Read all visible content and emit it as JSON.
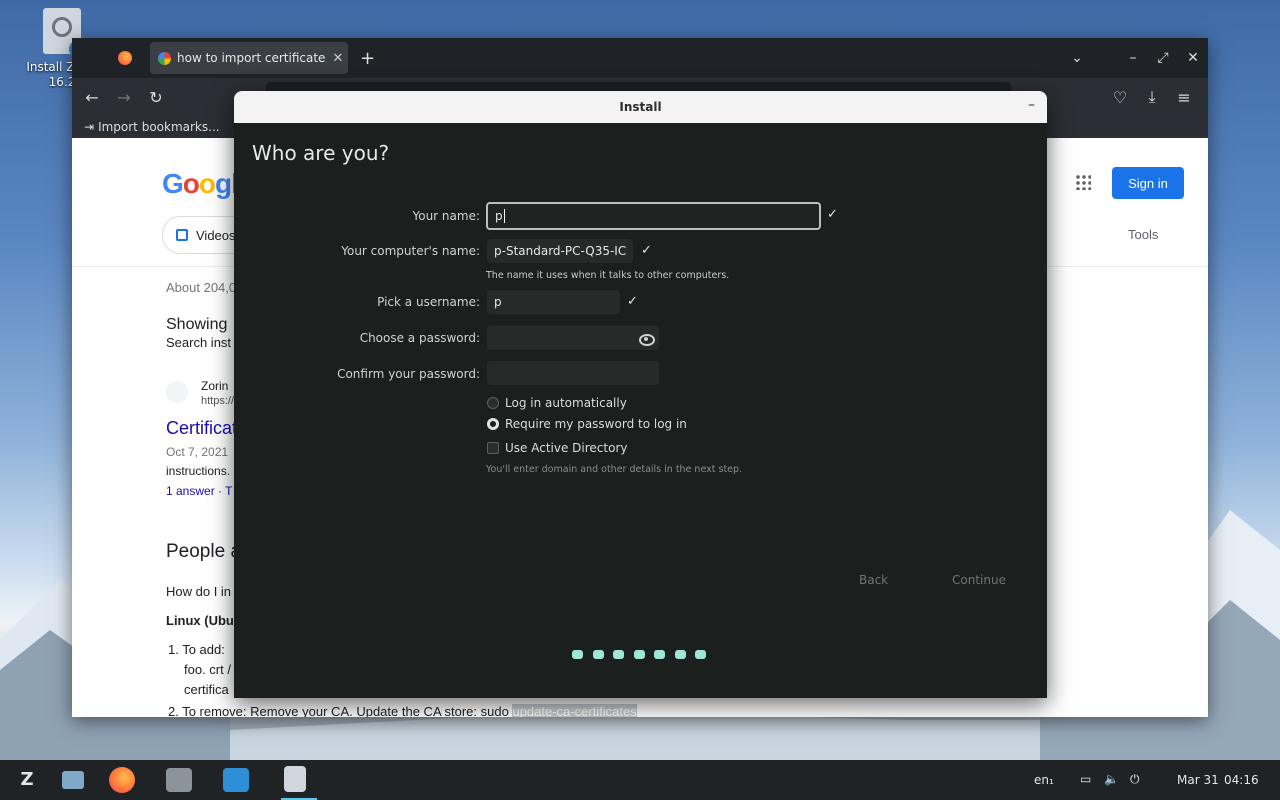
{
  "desktop": {
    "icon_label_line1": "Install Zorin",
    "icon_label_line2": "16.2"
  },
  "browser": {
    "tab_title": "how to import certificate i",
    "new_tab": "+",
    "bookmarks": {
      "import": "Import bookmarks..."
    },
    "page": {
      "signin": "Sign in",
      "videos": "Videos",
      "tools": "Tools",
      "about": "About 204,0",
      "showing": "Showing",
      "search_instead": "Search inst",
      "result_site": "Zorin",
      "result_url": "https://",
      "result_title": "Certificat",
      "result_date": "Oct 7, 2021",
      "result_snippet": "instructions.",
      "result_answers": "1 answer · T",
      "people_also": "People a",
      "how_do_i": "How do I in",
      "linux": "Linux (Ubu",
      "step1": "1. To add:",
      "step1b": "foo. crt /",
      "step1c": "certifica",
      "step2_text": "2. To remove: Remove your CA. Update the CA store: sudo ",
      "step2_highlight": "update-ca-certificates"
    }
  },
  "installer": {
    "title": "Install",
    "heading": "Who are you?",
    "fields": {
      "name_label": "Your name:",
      "name_value": "p",
      "computer_label": "Your computer's name:",
      "computer_value": "p-Standard-PC-Q35-IC",
      "computer_hint": "The name it uses when it talks to other computers.",
      "username_label": "Pick a username:",
      "username_value": "p",
      "password_label": "Choose a password:",
      "confirm_label": "Confirm your password:"
    },
    "options": {
      "auto_login": "Log in automatically",
      "require_password": "Require my password to log in",
      "active_directory": "Use Active Directory",
      "ad_hint": "You'll enter domain and other details in the next step."
    },
    "buttons": {
      "back": "Back",
      "continue": "Continue"
    },
    "progress_dots": 7
  },
  "taskbar": {
    "lang": "en₁",
    "date": "Mar 31",
    "time": "04:16"
  },
  "colors": {
    "installer_bg": "#1b1f1e",
    "accent_dots": "#9ee6d5",
    "google_blue": "#1a73e8"
  }
}
